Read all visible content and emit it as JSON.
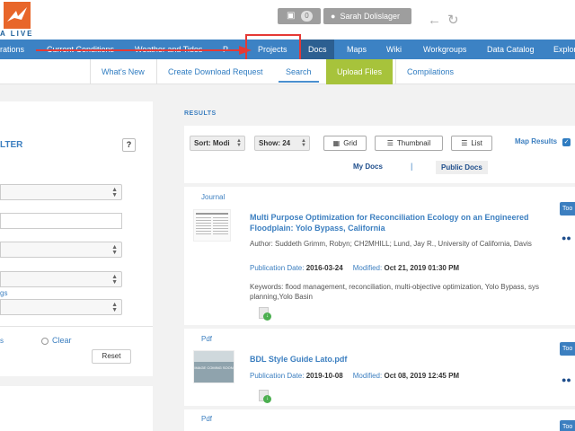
{
  "header": {
    "logo_text": "A LIVE",
    "cart_count": "0",
    "user_name": "Sarah Dolislager",
    "icons": {
      "cart": "cart-icon",
      "user": "user-icon",
      "back": "back-arrow-icon",
      "refresh": "refresh-icon"
    }
  },
  "main_nav": {
    "items": [
      {
        "label": "rations"
      },
      {
        "label": "Current Conditions"
      },
      {
        "label": "Weather and Tides"
      },
      {
        "label": "P"
      },
      {
        "label": "Projects"
      },
      {
        "label": "Docs",
        "active": true
      },
      {
        "label": "Maps"
      },
      {
        "label": "Wiki"
      },
      {
        "label": "Workgroups"
      },
      {
        "label": "Data Catalog"
      },
      {
        "label": "Explor"
      }
    ]
  },
  "sub_nav": {
    "items": [
      {
        "label": "What's New"
      },
      {
        "label": "Create Download Request"
      },
      {
        "label": "Search",
        "active": true
      },
      {
        "label": "Upload Files"
      },
      {
        "label": "Compilations"
      }
    ]
  },
  "filter": {
    "title": "LTER",
    "help_label": "?",
    "tags_link": "gs",
    "apply_link": "s",
    "clear_label": "Clear",
    "reset_label": "Reset"
  },
  "results": {
    "label": "RESULTS",
    "sort_label": "Sort: Modi",
    "show_label": "Show: 24",
    "grid_label": "Grid",
    "thumbnail_label": "Thumbnail",
    "list_label": "List",
    "map_results_label": "Map Results",
    "map_results_checked": true,
    "my_docs_label": "My Docs",
    "separator": "|",
    "public_docs_label": "Public Docs"
  },
  "docs": [
    {
      "type": "Journal",
      "title": "Multi Purpose Optimization for Reconciliation Ecology on an Engineered Floodplain: Yolo Bypass, California",
      "author": "Author: Suddeth Grimm, Robyn; CH2MHILL; Lund, Jay R., University of California, Davis",
      "pub_label": "Publication Date:",
      "pub_date": "2016-03-24",
      "mod_label": "Modified:",
      "mod_date": "Oct 21, 2019 01:30 PM",
      "keywords": "Keywords: flood management, reconciliation, multi-objective optimization, Yolo Bypass, sys planning,Yolo Basin",
      "tool_label": "Too"
    },
    {
      "type": "Pdf",
      "title": "BDL Style Guide Lato.pdf",
      "thumb_text": "IMAGE COMING SOON",
      "pub_label": "Publication Date:",
      "pub_date": "2019-10-08",
      "mod_label": "Modified:",
      "mod_date": "Oct 08, 2019 12:45 PM",
      "tool_label": "Too"
    },
    {
      "type": "Pdf",
      "tool_label": "Too"
    }
  ],
  "colors": {
    "nav_blue": "#3c82c4",
    "nav_active": "#2c5f91",
    "link_blue": "#3c7fc0",
    "upload_green": "#a7c33b",
    "highlight_red": "#e53935",
    "logo_orange": "#e8662a"
  }
}
